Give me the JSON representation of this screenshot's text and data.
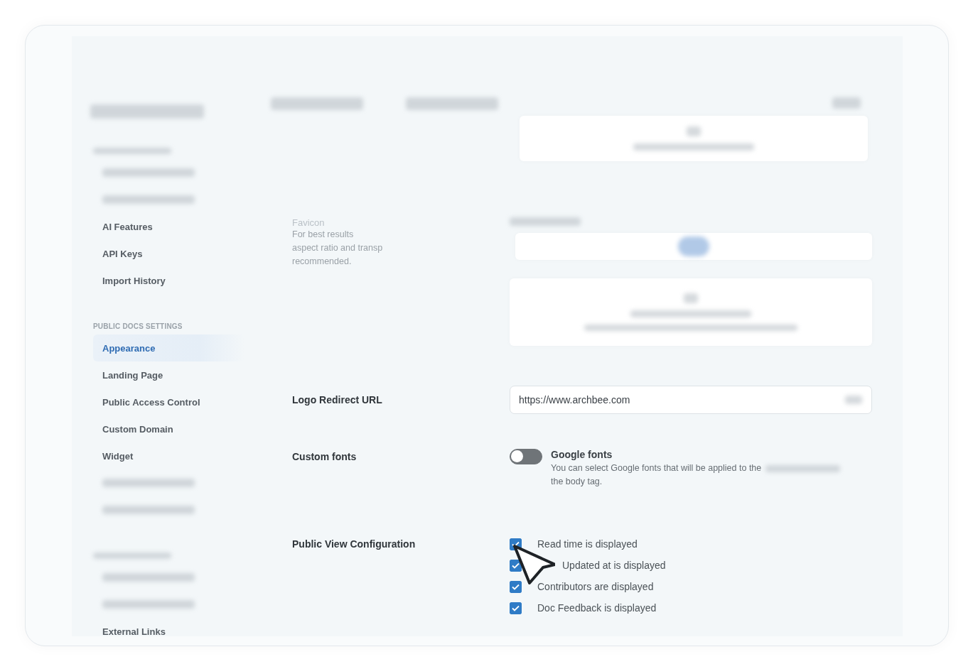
{
  "sidebar": {
    "items": [
      {
        "kind": "blurred_heading"
      },
      {
        "kind": "blurred"
      },
      {
        "kind": "blurred"
      },
      {
        "kind": "link",
        "label": "AI Features",
        "selected": false
      },
      {
        "kind": "link",
        "label": "API Keys",
        "selected": false
      },
      {
        "kind": "link",
        "label": "Import History",
        "selected": false
      },
      {
        "kind": "heading",
        "label": "PUBLIC DOCS SETTINGS"
      },
      {
        "kind": "link",
        "label": "Appearance",
        "selected": true
      },
      {
        "kind": "link",
        "label": "Landing Page",
        "selected": false
      },
      {
        "kind": "link",
        "label": "Public Access Control",
        "selected": false
      },
      {
        "kind": "link",
        "label": "Custom Domain",
        "selected": false
      },
      {
        "kind": "link",
        "label": "Widget",
        "selected": false
      },
      {
        "kind": "blurred"
      },
      {
        "kind": "blurred"
      },
      {
        "kind": "blurred_heading"
      },
      {
        "kind": "blurred"
      },
      {
        "kind": "blurred"
      },
      {
        "kind": "link",
        "label": "External Links",
        "selected": false
      }
    ]
  },
  "favicon": {
    "label": "Favicon",
    "description": [
      "For best results",
      "aspect ratio and transp",
      "recommended."
    ]
  },
  "logo_redirect": {
    "label": "Logo Redirect URL",
    "value": "https://www.archbee.com"
  },
  "custom_fonts": {
    "label": "Custom fonts",
    "toggle_label": "Google fonts",
    "on": false,
    "description": [
      "You can select Google fonts that will be applied to the",
      "the body tag."
    ]
  },
  "public_view": {
    "label": "Public View Configuration",
    "options": [
      {
        "label": "Read time is displayed",
        "checked": true
      },
      {
        "label": "Updated at is displayed",
        "checked": true,
        "kind": "partly_covered"
      },
      {
        "label": "Contributors are displayed",
        "checked": true
      },
      {
        "label": "Doc Feedback is displayed",
        "checked": true
      }
    ]
  }
}
